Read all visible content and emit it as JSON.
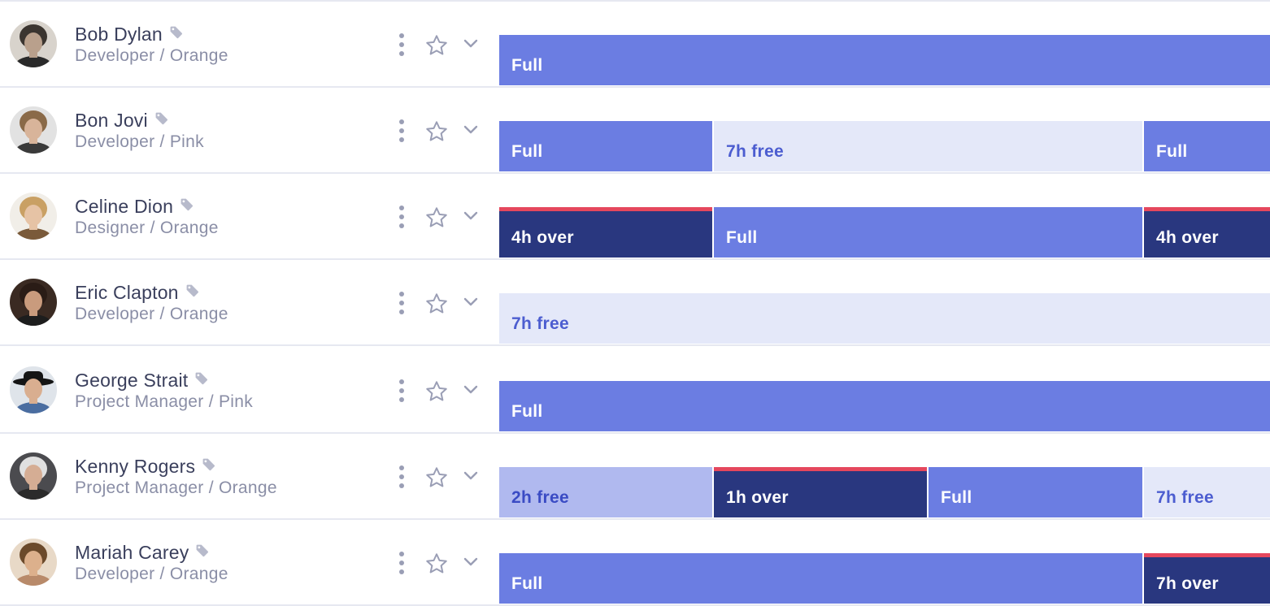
{
  "people": [
    {
      "name": "Bob Dylan",
      "subtitle": "Developer / Orange",
      "avatar": {
        "bg": "#d8d3cc",
        "hair": "#3b3530",
        "skin": "#b9a08c",
        "shirt": "#2a2a2a",
        "hat": false
      },
      "segments": [
        {
          "label": "Full",
          "type": "full",
          "span": 4
        }
      ]
    },
    {
      "name": "Bon Jovi",
      "subtitle": "Developer / Pink",
      "avatar": {
        "bg": "#e2e2e2",
        "hair": "#8a6a48",
        "skin": "#d8b49a",
        "shirt": "#3a3a3a",
        "hat": false
      },
      "segments": [
        {
          "label": "Full",
          "type": "full",
          "span": 1
        },
        {
          "label": "7h free",
          "type": "free",
          "span": 2
        },
        {
          "label": "Full",
          "type": "full",
          "span": 1
        }
      ]
    },
    {
      "name": "Celine Dion",
      "subtitle": "Designer / Orange",
      "avatar": {
        "bg": "#f1eee8",
        "hair": "#c9a064",
        "skin": "#e6c3a5",
        "shirt": "#7a5a3a",
        "hat": false
      },
      "segments": [
        {
          "label": "4h over",
          "type": "over",
          "span": 1
        },
        {
          "label": "Full",
          "type": "full",
          "span": 2
        },
        {
          "label": "4h over",
          "type": "over",
          "span": 1
        }
      ]
    },
    {
      "name": "Eric Clapton",
      "subtitle": "Developer / Orange",
      "avatar": {
        "bg": "#3a2a22",
        "hair": "#2a1c16",
        "skin": "#c99b7d",
        "shirt": "#1d1d1d",
        "hat": false
      },
      "segments": [
        {
          "label": "7h free",
          "type": "free",
          "span": 4
        }
      ]
    },
    {
      "name": "George Strait",
      "subtitle": "Project Manager / Pink",
      "avatar": {
        "bg": "#dfe4ea",
        "hair": "#1c1c1c",
        "skin": "#d9ae90",
        "shirt": "#4a6da0",
        "hat": true
      },
      "segments": [
        {
          "label": "Full",
          "type": "full",
          "span": 4
        }
      ]
    },
    {
      "name": "Kenny Rogers",
      "subtitle": "Project Manager / Orange",
      "avatar": {
        "bg": "#4b4b4f",
        "hair": "#e0e0e0",
        "skin": "#d5ad94",
        "shirt": "#2b2b2b",
        "hat": false
      },
      "segments": [
        {
          "label": "2h free",
          "type": "part",
          "span": 1
        },
        {
          "label": "1h over",
          "type": "over",
          "span": 1
        },
        {
          "label": "Full",
          "type": "full",
          "span": 1
        },
        {
          "label": "7h free",
          "type": "free",
          "span": 1
        }
      ]
    },
    {
      "name": "Mariah Carey",
      "subtitle": "Developer / Orange",
      "avatar": {
        "bg": "#e8d9c7",
        "hair": "#6b4a2b",
        "skin": "#dcb08c",
        "shirt": "#b88a6a",
        "hat": false
      },
      "segments": [
        {
          "label": "Full",
          "type": "full",
          "span": 3
        },
        {
          "label": "7h over",
          "type": "over",
          "span": 1
        }
      ]
    }
  ],
  "icons": {
    "tag": "tag-icon",
    "more": "more-vertical-icon",
    "star": "star-outline-icon",
    "expand": "chevron-down-icon"
  },
  "colors": {
    "full": "#6b7de2",
    "free": "#e4e8f9",
    "partial_free": "#b0b9ef",
    "over": "#29377f",
    "over_marker": "#e5475d",
    "name_text": "#3a3f5c",
    "subtitle_text": "#8a8ea6",
    "icon": "#9a9eb5"
  }
}
